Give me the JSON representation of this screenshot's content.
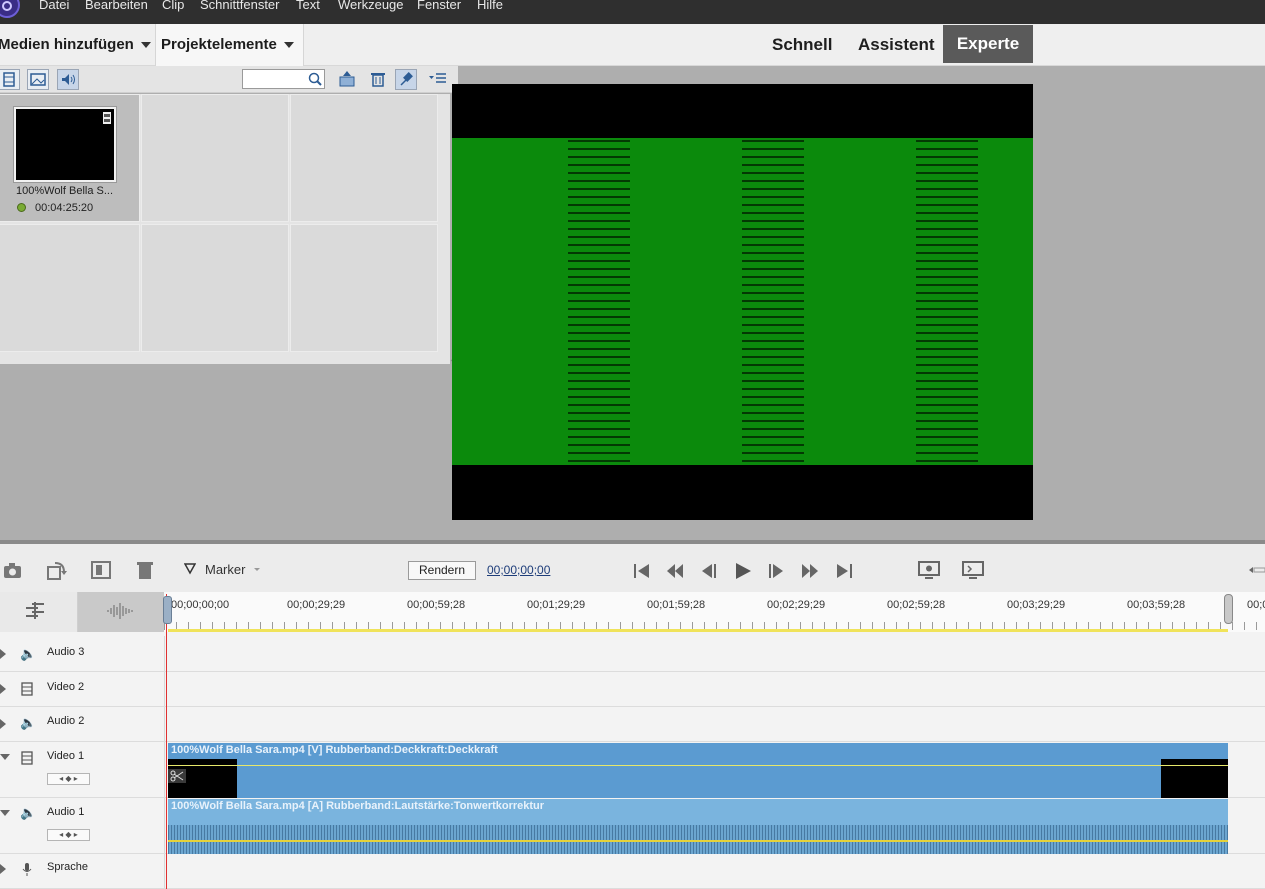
{
  "menu": [
    "Datei",
    "Bearbeiten",
    "Clip",
    "Schnittfenster",
    "Text",
    "Werkzeuge",
    "Fenster",
    "Hilfe"
  ],
  "mode_bar": {
    "add_media": "Medien hinzufügen",
    "project_elements": "Projektelemente",
    "modes": [
      "Schnell",
      "Assistent",
      "Experte"
    ],
    "active_mode": "Experte"
  },
  "project": {
    "clip_name": "100%Wolf Bella S...",
    "clip_duration": "00:04:25:20"
  },
  "timeline_toolbar": {
    "marker_label": "Marker",
    "render_label": "Rendern",
    "timecode": "00;00;00;00"
  },
  "ruler_ticks": [
    "00;00;00;00",
    "00;00;29;29",
    "00;00;59;28",
    "00;01;29;29",
    "00;01;59;28",
    "00;02;29;29",
    "00;02;59;28",
    "00;03;29;29",
    "00;03;59;28",
    "00;0"
  ],
  "tracks": [
    {
      "name": "Audio 3",
      "kind": "audio"
    },
    {
      "name": "Video 2",
      "kind": "video"
    },
    {
      "name": "Audio 2",
      "kind": "audio"
    },
    {
      "name": "Video 1",
      "kind": "video"
    },
    {
      "name": "Audio 1",
      "kind": "audio"
    },
    {
      "name": "Sprache",
      "kind": "mic"
    }
  ],
  "clips": {
    "video_title": "100%Wolf Bella Sara.mp4 [V] Rubberband:Deckkraft:Deckkraft",
    "audio_title": "100%Wolf Bella Sara.mp4 [A] Rubberband:Lautstärke:Tonwertkorrektur"
  },
  "colors": {
    "preview_green": "#0b8a0c",
    "clip_video": "#5b9bd1",
    "clip_audio": "#7ab4de",
    "playhead": "#e03030"
  }
}
